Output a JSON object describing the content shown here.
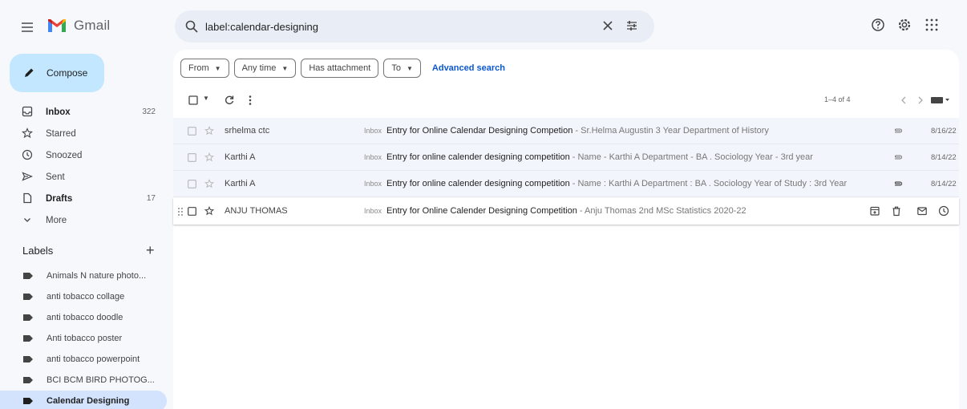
{
  "app": {
    "name": "Gmail"
  },
  "search": {
    "query": "label:calendar-designing"
  },
  "compose": {
    "label": "Compose"
  },
  "nav": [
    {
      "label": "Inbox",
      "count": "322",
      "icon": "inbox-icon"
    },
    {
      "label": "Starred",
      "count": "",
      "icon": "star-icon"
    },
    {
      "label": "Snoozed",
      "count": "",
      "icon": "clock-icon"
    },
    {
      "label": "Sent",
      "count": "",
      "icon": "send-icon"
    },
    {
      "label": "Drafts",
      "count": "17",
      "icon": "draft-icon"
    },
    {
      "label": "More",
      "count": "",
      "icon": "chevron-down-icon"
    }
  ],
  "labels": {
    "heading": "Labels",
    "items": [
      "Animals N nature photo...",
      "anti tobacco collage",
      "anti tobacco doodle",
      "Anti tobacco poster",
      "anti tobacco powerpoint",
      "BCI BCM BIRD PHOTOG...",
      "Calendar Designing"
    ]
  },
  "filters": {
    "from": "From",
    "time": "Any time",
    "attachment": "Has attachment",
    "to": "To",
    "advanced": "Advanced search"
  },
  "pager": {
    "range": "1–4 of 4"
  },
  "emails": [
    {
      "sender": "srhelma ctc",
      "tag": "Inbox",
      "subject": "Entry for Online Calendar Designing Competion",
      "snippet": " - Sr.Helma Augustin 3 Year Department of History",
      "date": "8/16/22"
    },
    {
      "sender": "Karthi A",
      "tag": "Inbox",
      "subject": "Entry for online calender designing competition",
      "snippet": " - Name - Karthi A Department - BA . Sociology Year - 3rd year",
      "date": "8/14/22"
    },
    {
      "sender": "Karthi A",
      "tag": "Inbox",
      "subject": "Entry for online calender designing competition",
      "snippet": " - Name : Karthi A Department : BA . Sociology Year of Study : 3rd Year",
      "date": "8/14/22"
    },
    {
      "sender": "ANJU THOMAS",
      "tag": "Inbox",
      "subject": "Entry for Online Calender Designing Competition",
      "snippet": " - Anju Thomas 2nd MSc Statistics 2020-22",
      "date": ""
    }
  ],
  "colors": {
    "compose_bg": "#c2e7ff",
    "active_label_bg": "#d3e3fd",
    "link": "#0b57d0"
  }
}
